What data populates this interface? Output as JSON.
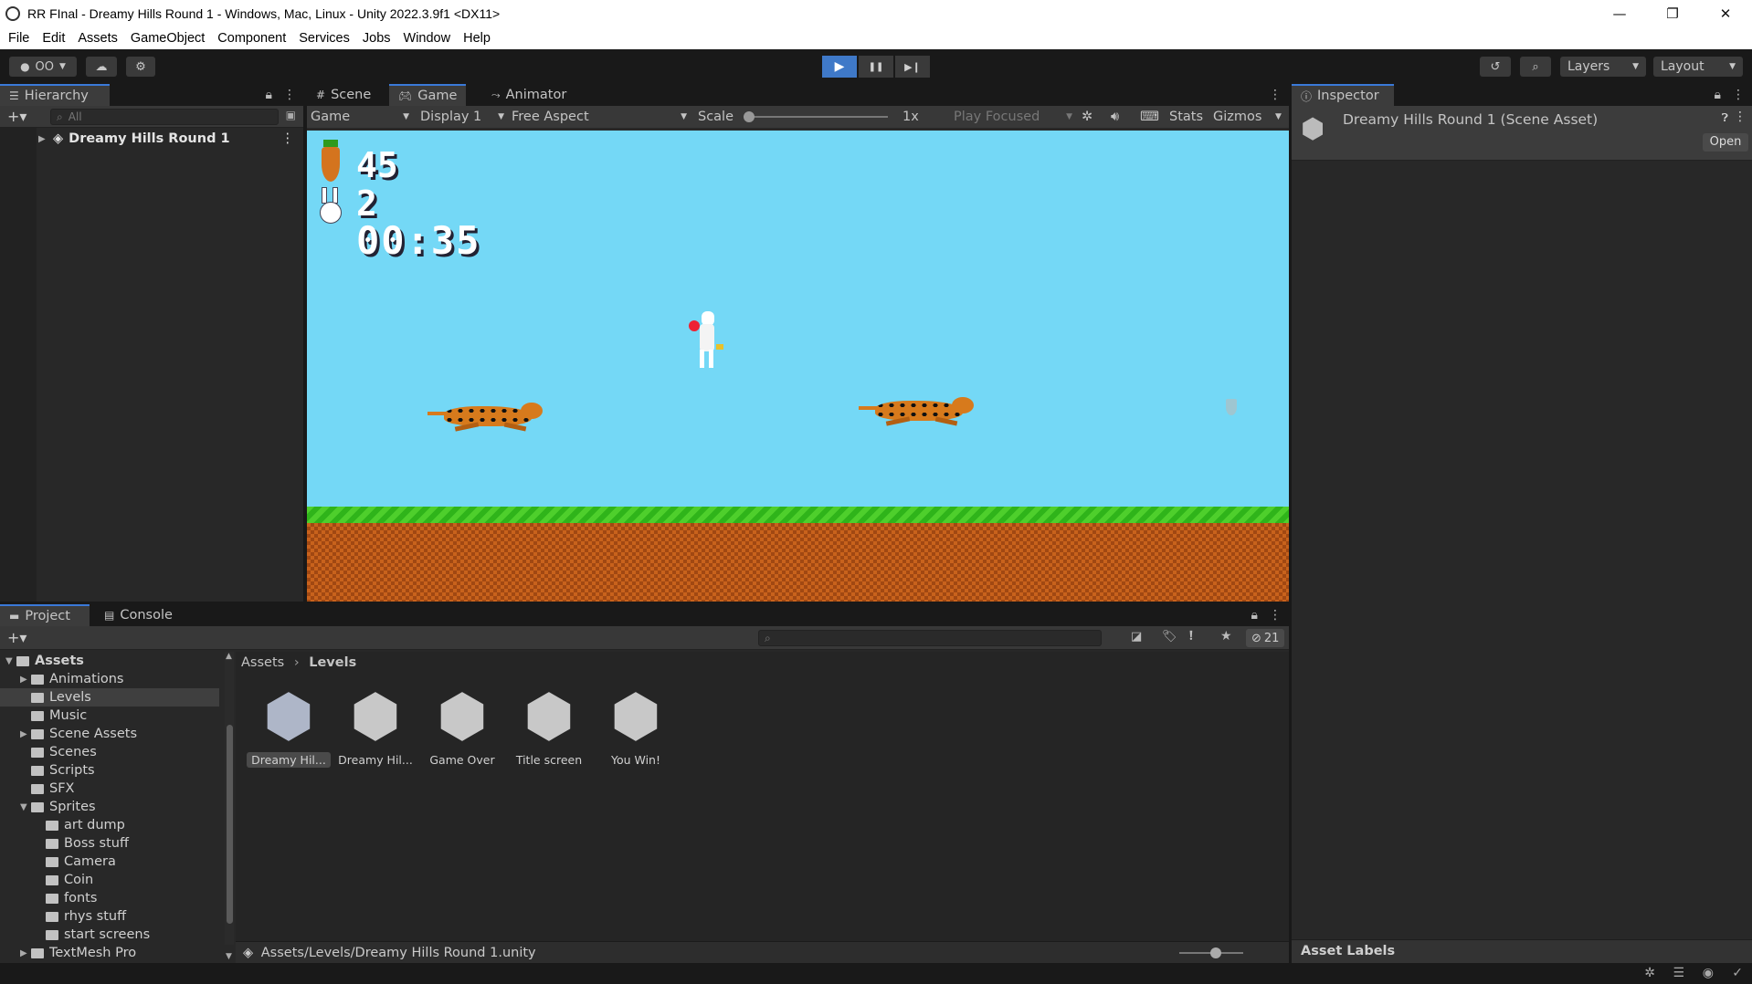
{
  "window": {
    "title": "RR FInal - Dreamy Hills Round 1 - Windows, Mac, Linux - Unity 2022.3.9f1 <DX11>",
    "controls": [
      "—",
      "❐",
      "✕"
    ]
  },
  "menu": [
    "File",
    "Edit",
    "Assets",
    "GameObject",
    "Component",
    "Services",
    "Jobs",
    "Window",
    "Help"
  ],
  "toolbar": {
    "account_label": "OO",
    "layers_label": "Layers",
    "layout_label": "Layout",
    "play_icons": [
      "▶",
      "❚❚",
      "▶❙"
    ]
  },
  "hierarchy": {
    "tab": "Hierarchy",
    "search_placeholder": "All",
    "scene_item": "Dreamy Hills Round 1"
  },
  "scene_tabs": [
    "Scene",
    "Game",
    "Animator"
  ],
  "game_bar": {
    "mode": "Game",
    "display": "Display 1",
    "aspect": "Free Aspect",
    "scale_label": "Scale",
    "scale_value": "1x",
    "play_focused": "Play Focused",
    "stats": "Stats",
    "gizmos": "Gizmos"
  },
  "game": {
    "carrots": "45",
    "lives": "2",
    "timer": "00:35"
  },
  "inspector": {
    "tab": "Inspector",
    "asset_title": "Dreamy Hills Round 1 (Scene Asset)",
    "open_button": "Open",
    "asset_labels": "Asset Labels"
  },
  "project": {
    "tabs": [
      "Project",
      "Console"
    ],
    "hidden_count": "21",
    "breadcrumb_root": "Assets",
    "breadcrumb_current": "Levels",
    "tree": [
      {
        "label": "Assets",
        "depth": 0,
        "arrow": "▼",
        "open": true
      },
      {
        "label": "Animations",
        "depth": 1,
        "arrow": "▶"
      },
      {
        "label": "Levels",
        "depth": 1,
        "arrow": "",
        "selected": true
      },
      {
        "label": "Music",
        "depth": 1,
        "arrow": ""
      },
      {
        "label": "Scene Assets",
        "depth": 1,
        "arrow": "▶"
      },
      {
        "label": "Scenes",
        "depth": 1,
        "arrow": ""
      },
      {
        "label": "Scripts",
        "depth": 1,
        "arrow": ""
      },
      {
        "label": "SFX",
        "depth": 1,
        "arrow": ""
      },
      {
        "label": "Sprites",
        "depth": 1,
        "arrow": "▼",
        "open": true
      },
      {
        "label": "art dump",
        "depth": 2,
        "arrow": ""
      },
      {
        "label": "Boss stuff",
        "depth": 2,
        "arrow": ""
      },
      {
        "label": "Camera",
        "depth": 2,
        "arrow": ""
      },
      {
        "label": "Coin",
        "depth": 2,
        "arrow": ""
      },
      {
        "label": "fonts",
        "depth": 2,
        "arrow": ""
      },
      {
        "label": "rhys stuff",
        "depth": 2,
        "arrow": ""
      },
      {
        "label": "start screens",
        "depth": 2,
        "arrow": ""
      },
      {
        "label": "TextMesh Pro",
        "depth": 1,
        "arrow": "▶"
      }
    ],
    "assets": [
      "Dreamy Hil...",
      "Dreamy Hil...",
      "Game Over",
      "Title screen",
      "You Win!"
    ],
    "footer_path": "Assets/Levels/Dreamy Hills Round 1.unity"
  }
}
